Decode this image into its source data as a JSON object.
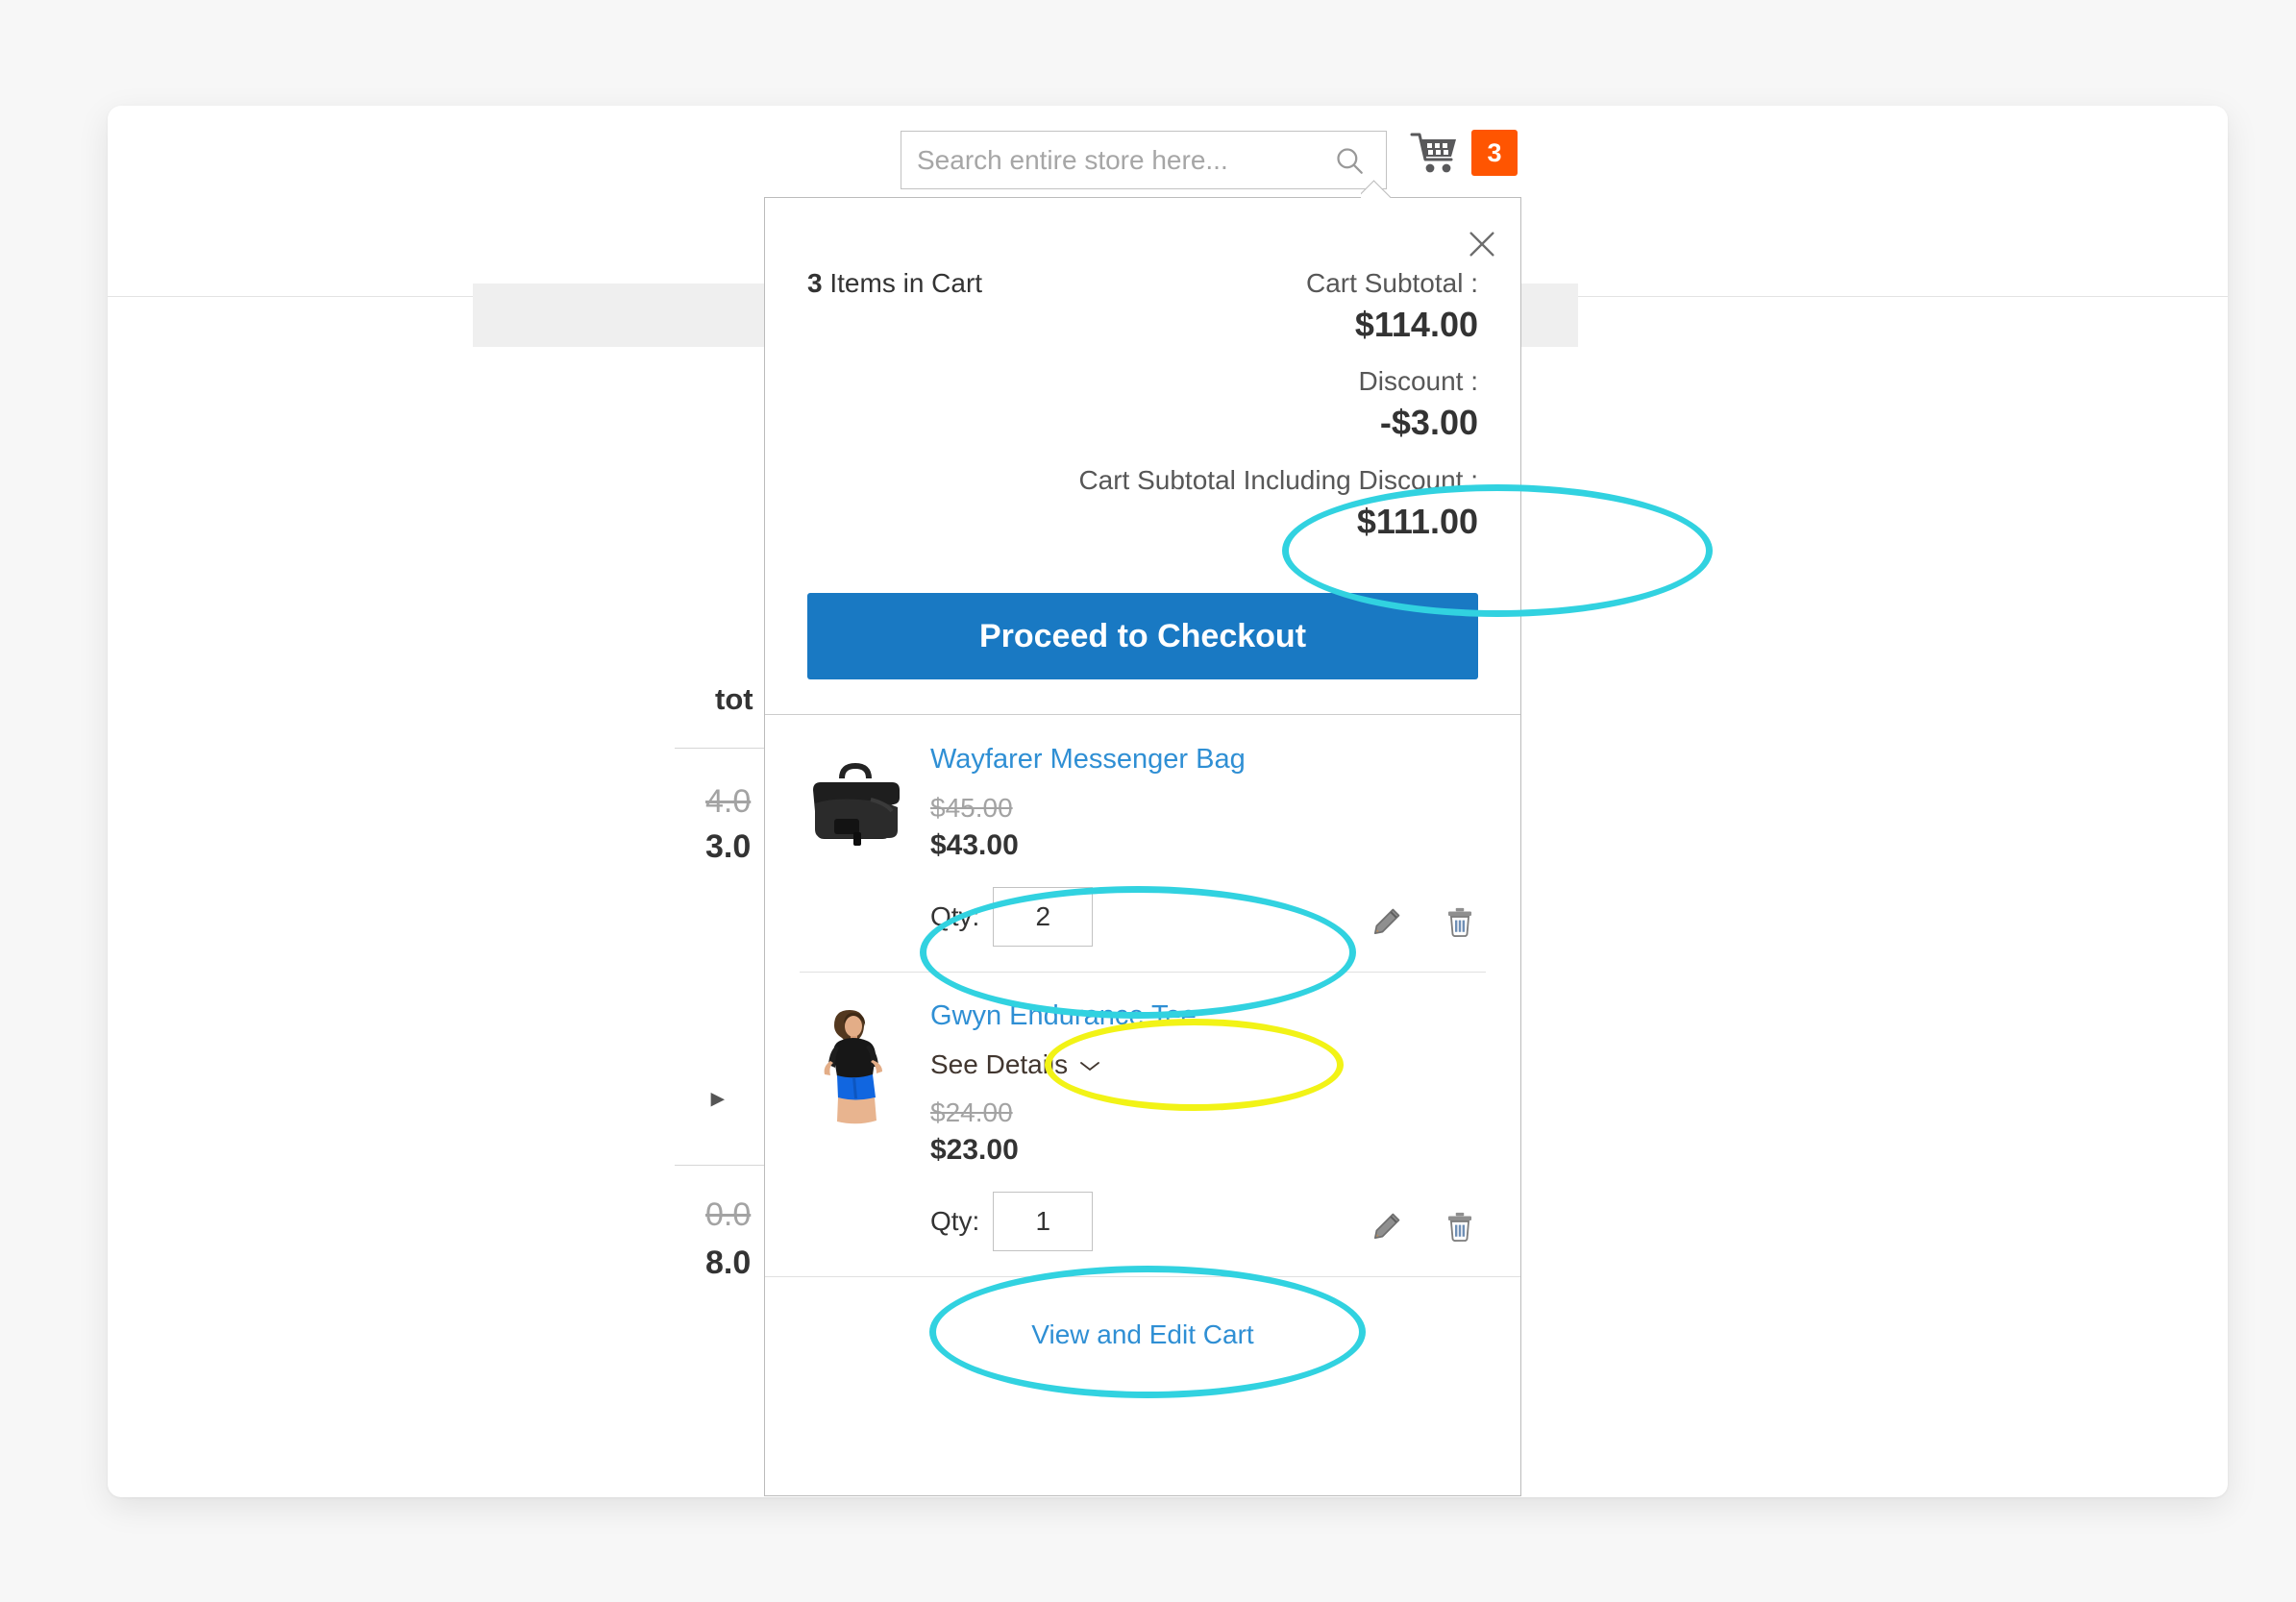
{
  "header": {
    "search": {
      "placeholder": "Search entire store here...",
      "value": "",
      "icon": "search-icon"
    },
    "cart": {
      "icon": "shopping-cart-icon",
      "counter": "3"
    }
  },
  "background": {
    "total_label": "tot",
    "old_price_1": "4.0",
    "new_price_1": "3.0",
    "bullet": "▸",
    "old_price_2": "0.0",
    "new_price_2": "8.0"
  },
  "mini_cart": {
    "close_icon": "close-icon",
    "items_in_cart_count": "3",
    "items_in_cart_label": "Items in Cart",
    "totals": [
      {
        "label": "Cart Subtotal :",
        "value": "$114.00"
      },
      {
        "label": "Discount :",
        "value": "-$3.00"
      },
      {
        "label": "Cart Subtotal Including Discount :",
        "value": "$111.00"
      }
    ],
    "checkout_button": "Proceed to Checkout",
    "items": [
      {
        "name": "Wayfarer Messenger Bag",
        "thumb": "messenger-bag-thumbnail",
        "see_details": null,
        "price_old": "$45.00",
        "price_new": "$43.00",
        "qty_label": "Qty:",
        "qty_value": "2",
        "edit_icon": "pencil-edit-icon",
        "delete_icon": "trash-delete-icon"
      },
      {
        "name": "Gwyn Endurance Tee",
        "thumb": "tee-shirt-model-thumbnail",
        "see_details": "See Details",
        "price_old": "$24.00",
        "price_new": "$23.00",
        "qty_label": "Qty:",
        "qty_value": "1",
        "edit_icon": "pencil-edit-icon",
        "delete_icon": "trash-delete-icon"
      }
    ],
    "footer_link": "View and Edit Cart"
  },
  "annotations": [
    {
      "name": "discount-highlight",
      "color": "#31d2e0",
      "shape": "ellipse"
    },
    {
      "name": "item-1-price-highlight",
      "color": "#31d2e0",
      "shape": "ellipse"
    },
    {
      "name": "item-1-qty-highlight",
      "color": "#f2f316",
      "shape": "ellipse"
    },
    {
      "name": "item-2-price-highlight",
      "color": "#31d2e0",
      "shape": "ellipse"
    }
  ],
  "colors": {
    "accent_blue": "#1979c3",
    "link_blue": "#2f8fd4",
    "cart_badge_orange": "#ff5501",
    "highlight_cyan": "#31d2e0",
    "highlight_yellow": "#f2f316"
  }
}
